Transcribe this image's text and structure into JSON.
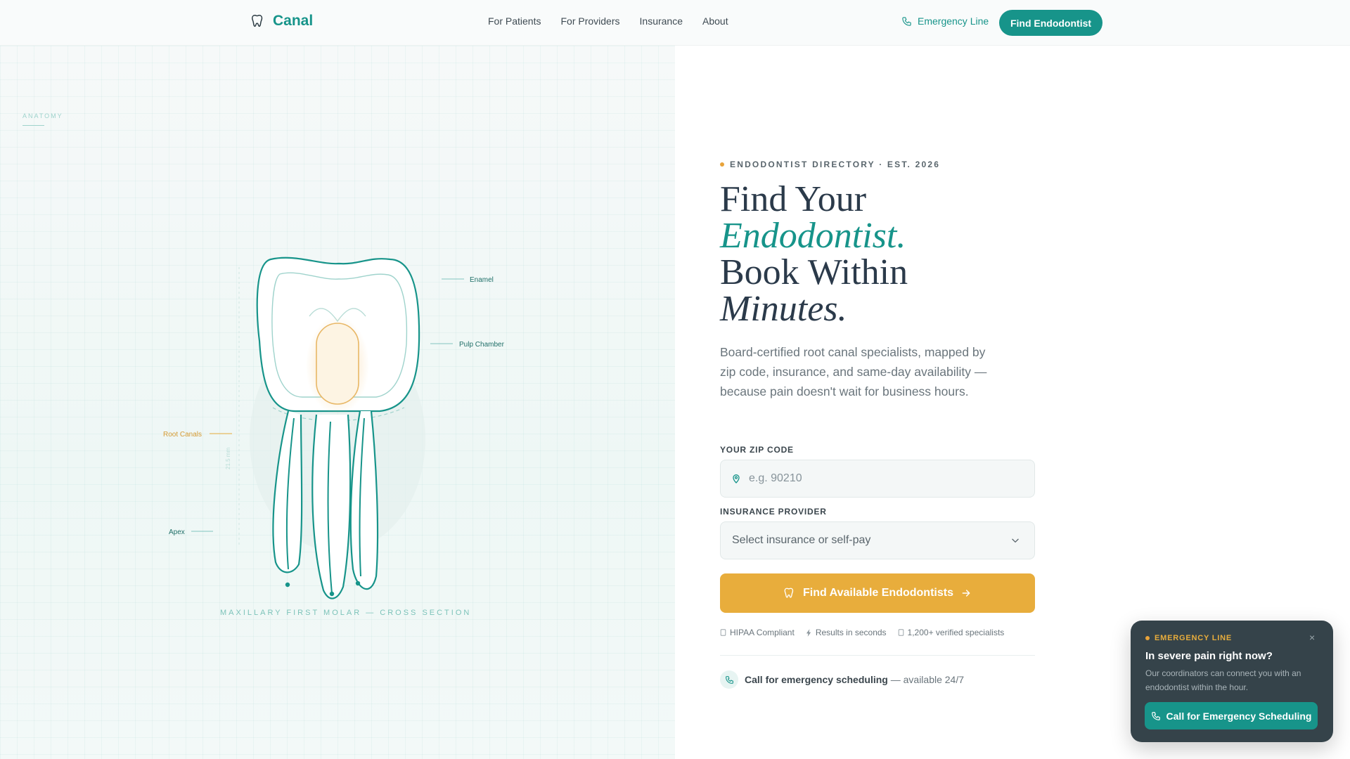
{
  "header": {
    "brand": "Canal",
    "brand_icon": "tooth-icon",
    "nav": [
      "For Patients",
      "For Providers",
      "Insurance",
      "About"
    ],
    "emergency_link": "Emergency Line",
    "cta": "Find Endodontist"
  },
  "illustration": {
    "tag": "ANATOMY",
    "labels": {
      "enamel": "Enamel",
      "pulp_chamber": "Pulp Chamber",
      "root_canals": "Root Canals",
      "apex": "Apex",
      "measure": "21.5 mm"
    },
    "caption": "MAXILLARY FIRST MOLAR — CROSS SECTION"
  },
  "hero": {
    "eyebrow": "ENDODONTIST DIRECTORY · EST. 2026",
    "title_line1": "Find Your",
    "title_line2": "Endodontist.",
    "title_line3": "Book Within",
    "title_line4": "Minutes.",
    "description": "Board-certified root canal specialists, mapped by zip code, insurance, and same-day availability — because pain doesn't wait for business hours."
  },
  "form": {
    "zip_label": "YOUR ZIP CODE",
    "zip_placeholder": "e.g. 90210",
    "zip_value": "",
    "insurance_label": "INSURANCE PROVIDER",
    "insurance_selected": "Select insurance or self-pay",
    "submit": "Find Available Endodontists"
  },
  "trust": {
    "hipaa": "HIPAA Compliant",
    "results": "Results in seconds",
    "verified": "1,200+ verified specialists"
  },
  "call": {
    "strong": "Call for emergency scheduling",
    "rest": " — available 24/7"
  },
  "popup": {
    "tag": "EMERGENCY LINE",
    "title": "In severe pain right now?",
    "body": "Our coordinators can connect you with an endodontist within the hour.",
    "button": "Call for Emergency Scheduling",
    "close": "×"
  },
  "colors": {
    "teal": "#17948a",
    "amber": "#e8ad3c",
    "ink": "#2b3a4a",
    "popup_bg": "#35434a"
  }
}
